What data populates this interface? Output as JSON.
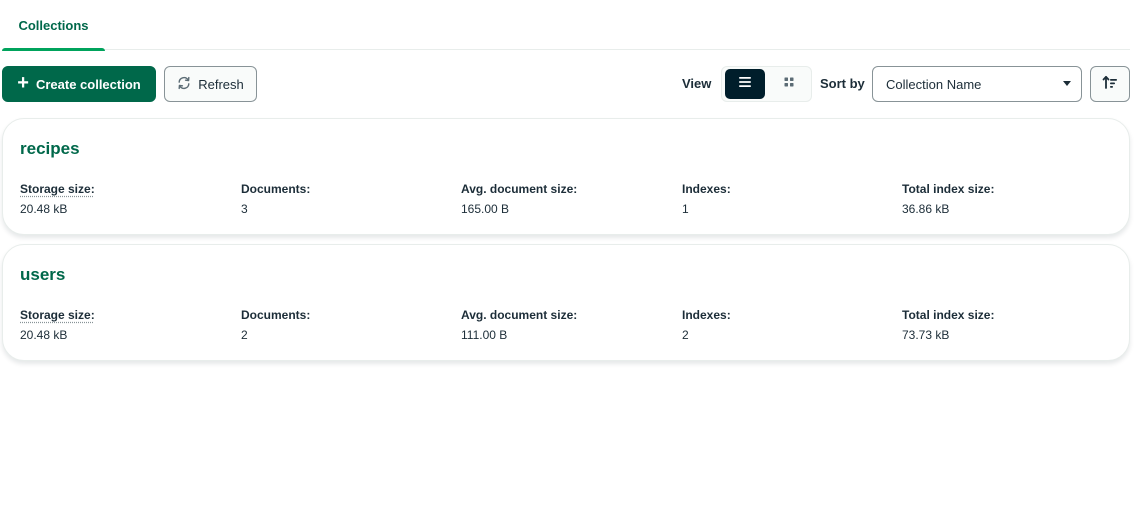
{
  "tabs": [
    {
      "label": "Collections",
      "active": true
    }
  ],
  "toolbar": {
    "create_label": "Create collection",
    "refresh_label": "Refresh",
    "view_label": "View",
    "sort_label": "Sort by",
    "sort_value": "Collection Name"
  },
  "stat_labels": {
    "storage": "Storage size:",
    "documents": "Documents:",
    "avg_size": "Avg. document size:",
    "indexes": "Indexes:",
    "index_size": "Total index size:"
  },
  "collections": [
    {
      "name": "recipes",
      "storage": "20.48 kB",
      "documents": "3",
      "avg_size": "165.00 B",
      "indexes": "1",
      "index_size": "36.86 kB"
    },
    {
      "name": "users",
      "storage": "20.48 kB",
      "documents": "2",
      "avg_size": "111.00 B",
      "indexes": "2",
      "index_size": "73.73 kB"
    }
  ],
  "colors": {
    "brand_green": "#00684a",
    "accent_green": "#00a35c",
    "dark": "#001e2b"
  }
}
